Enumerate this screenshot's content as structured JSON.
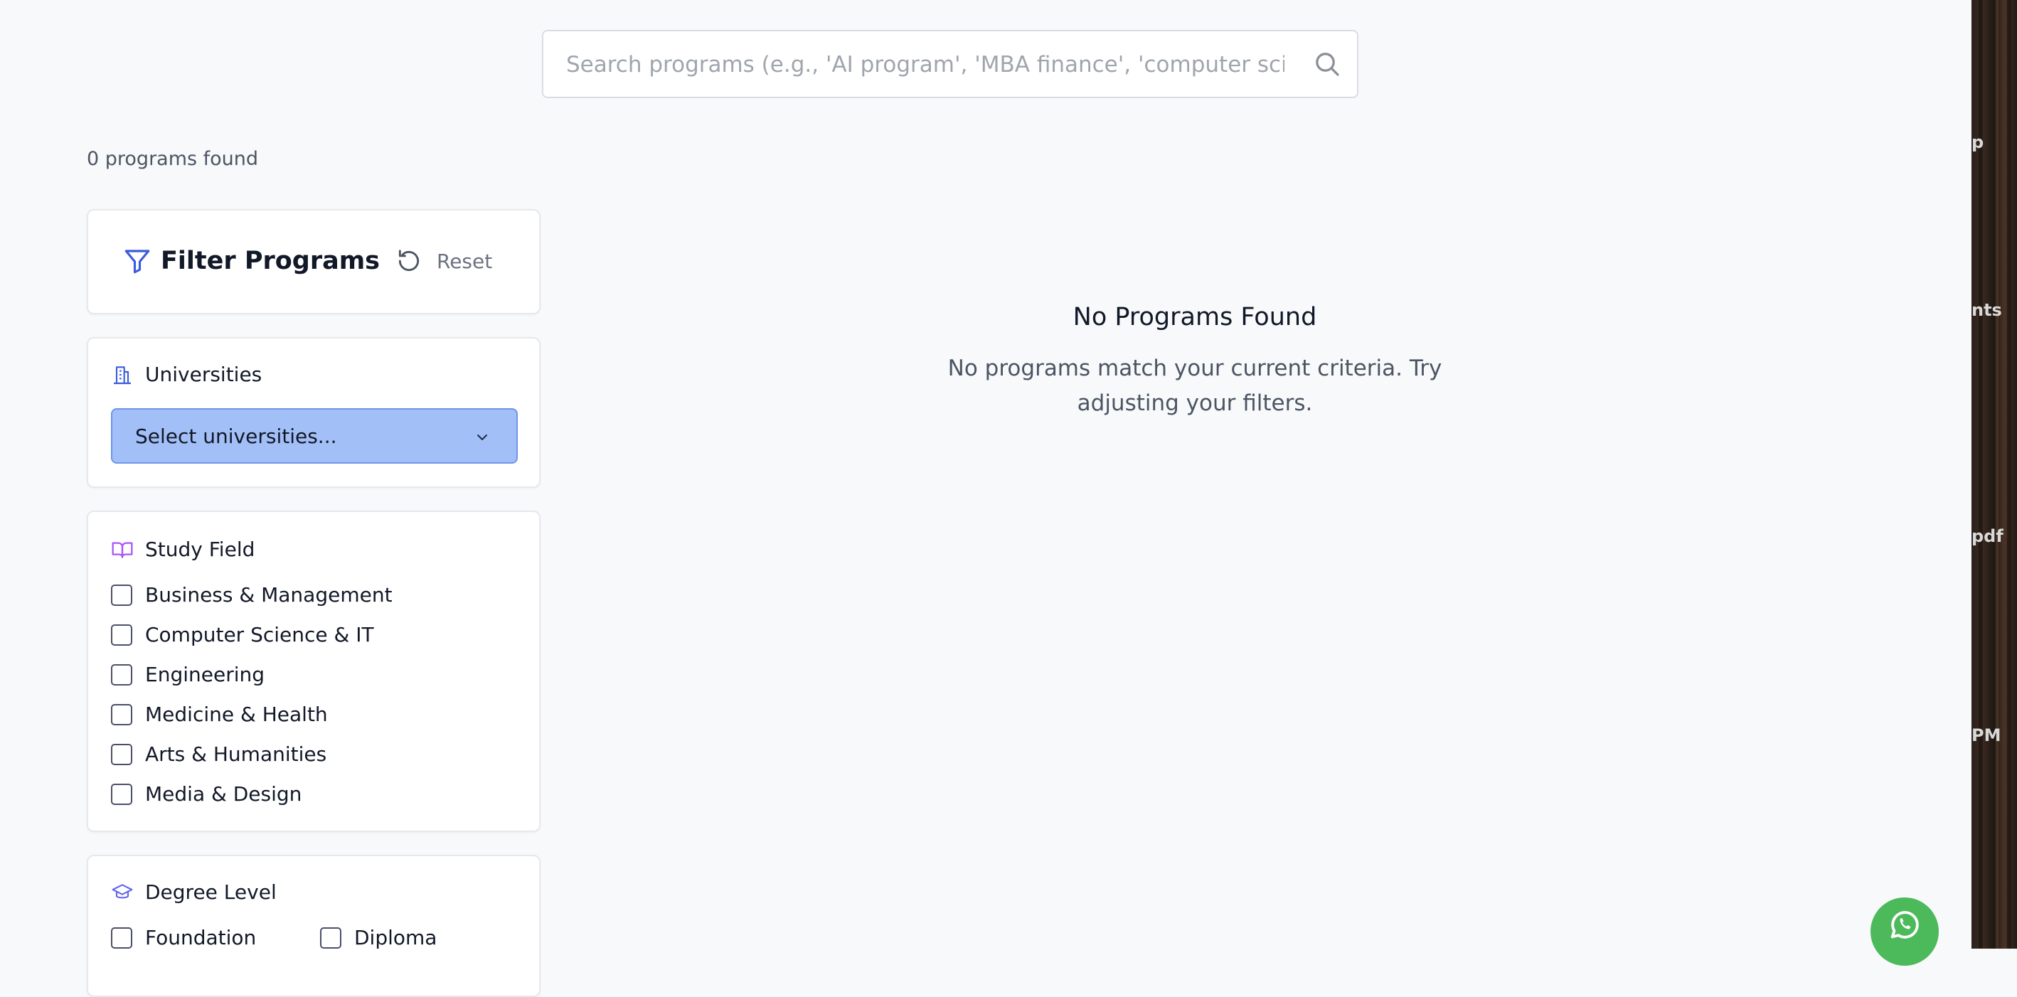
{
  "search": {
    "placeholder": "Search programs (e.g., 'AI program', 'MBA finance', 'computer science')",
    "value": ""
  },
  "results": {
    "count_text": "0 programs found"
  },
  "filters": {
    "title": "Filter Programs",
    "reset_label": "Reset",
    "universities": {
      "label": "Universities",
      "select_placeholder": "Select universities..."
    },
    "study_field": {
      "label": "Study Field",
      "options": [
        {
          "label": "Business & Management",
          "checked": false
        },
        {
          "label": "Computer Science & IT",
          "checked": false
        },
        {
          "label": "Engineering",
          "checked": false
        },
        {
          "label": "Medicine & Health",
          "checked": false
        },
        {
          "label": "Arts & Humanities",
          "checked": false
        },
        {
          "label": "Media & Design",
          "checked": false
        }
      ]
    },
    "degree_level": {
      "label": "Degree Level",
      "options": [
        {
          "label": "Foundation",
          "checked": false
        },
        {
          "label": "Diploma",
          "checked": false
        }
      ]
    }
  },
  "empty_state": {
    "title": "No Programs Found",
    "message": "No programs match your current criteria. Try adjusting your filters."
  },
  "background_strip": {
    "fragments": [
      "p",
      "nts",
      "pdf",
      "PM"
    ]
  },
  "icons": {
    "search": "search-icon",
    "filter": "filter-icon",
    "reset": "reset-icon",
    "universities": "building-icon",
    "study_field": "book-open-icon",
    "degree_level": "graduation-cap-icon",
    "dropdown": "chevron-down-icon",
    "chat": "whatsapp-icon"
  },
  "colors": {
    "accent": "#3b5bdb",
    "select_bg": "#a3bff7",
    "study_field_icon": "#a855f7",
    "whatsapp": "#4cba5b"
  }
}
